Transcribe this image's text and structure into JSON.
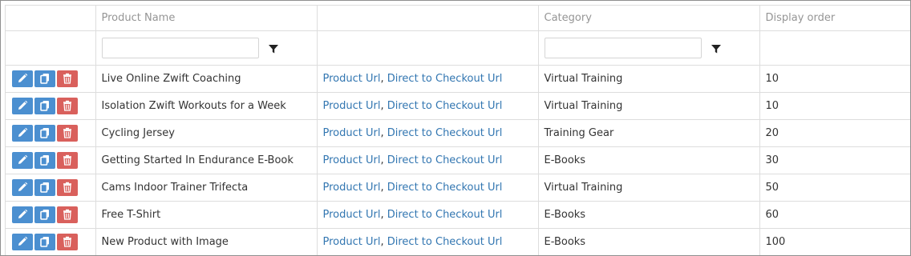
{
  "columns": {
    "product_name": "Product Name",
    "category": "Category",
    "display_order": "Display order"
  },
  "filters": {
    "product_name_value": "",
    "category_value": ""
  },
  "links": {
    "product_url": "Product Url",
    "separator": ",",
    "checkout_url": "Direct to Checkout Url"
  },
  "colors": {
    "edit_button": "#4b8fd0",
    "copy_button": "#4b8fd0",
    "delete_button": "#d9605c",
    "link": "#3276b1"
  },
  "icons": {
    "edit": "pencil-icon",
    "copy": "copy-icon",
    "delete": "trash-icon",
    "filter": "filter-icon"
  },
  "rows": [
    {
      "name": "Live Online Zwift Coaching",
      "category": "Virtual Training",
      "order": "10"
    },
    {
      "name": "Isolation Zwift Workouts for a Week",
      "category": "Virtual Training",
      "order": "10"
    },
    {
      "name": "Cycling Jersey",
      "category": "Training Gear",
      "order": "20"
    },
    {
      "name": "Getting Started In Endurance E-Book",
      "category": "E-Books",
      "order": "30"
    },
    {
      "name": "Cams Indoor Trainer Trifecta",
      "category": "Virtual Training",
      "order": "50"
    },
    {
      "name": "Free T-Shirt",
      "category": "E-Books",
      "order": "60"
    },
    {
      "name": "New Product with Image",
      "category": "E-Books",
      "order": "100"
    }
  ]
}
